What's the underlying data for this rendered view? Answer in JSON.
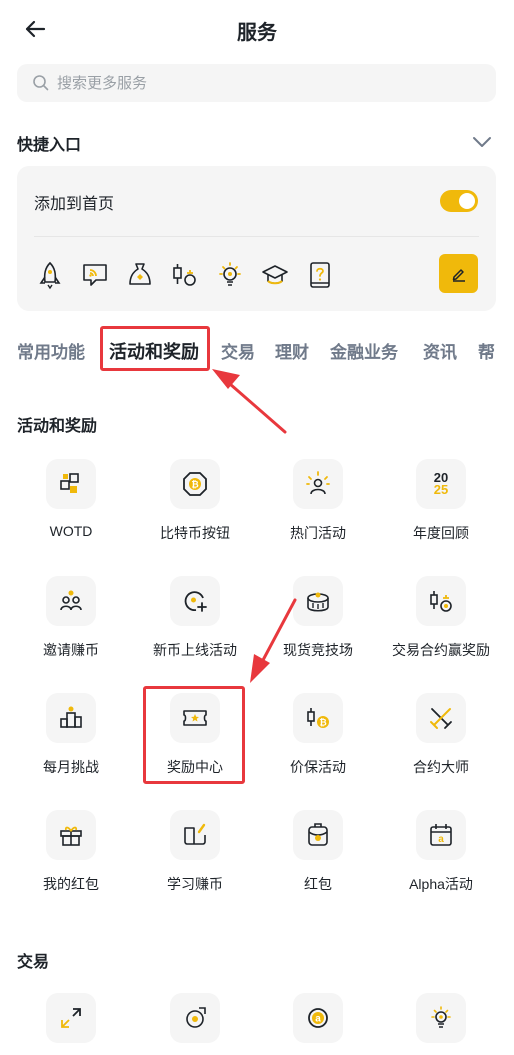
{
  "header": {
    "title": "服务"
  },
  "search": {
    "placeholder": "搜索更多服务"
  },
  "quick_access": {
    "title": "快捷入口",
    "add_to_home_label": "添加到首页",
    "toggle_on": true,
    "icons": [
      "rocket-icon",
      "broadcast-icon",
      "moneybag-icon",
      "trade-icon",
      "bulb-icon",
      "graduation-cap-icon",
      "help-book-icon"
    ]
  },
  "tabs": [
    "常用功能",
    "活动和奖励",
    "交易",
    "理财",
    "金融业务",
    "资讯",
    "帮"
  ],
  "active_tab": "活动和奖励",
  "rewards_section": {
    "title": "活动和奖励",
    "items": [
      {
        "label": "WOTD",
        "icon": "wotd-icon"
      },
      {
        "label": "比特币按钮",
        "icon": "bitcoin-button-icon"
      },
      {
        "label": "热门活动",
        "icon": "hot-activity-icon"
      },
      {
        "label": "年度回顾",
        "icon": "year-review-icon",
        "icon_text_top": "20",
        "icon_text_bottom": "25"
      },
      {
        "label": "邀请赚币",
        "icon": "invite-icon"
      },
      {
        "label": "新币上线活动",
        "icon": "new-coin-icon"
      },
      {
        "label": "现货竞技场",
        "icon": "spot-arena-icon"
      },
      {
        "label": "交易合约赢奖励",
        "icon": "futures-reward-icon"
      },
      {
        "label": "每月挑战",
        "icon": "monthly-challenge-icon"
      },
      {
        "label": "奖励中心",
        "icon": "ticket-icon"
      },
      {
        "label": "价保活动",
        "icon": "price-protect-icon"
      },
      {
        "label": "合约大师",
        "icon": "swords-icon"
      },
      {
        "label": "我的红包",
        "icon": "gift-icon"
      },
      {
        "label": "学习赚币",
        "icon": "learn-earn-icon"
      },
      {
        "label": "红包",
        "icon": "red-packet-icon"
      },
      {
        "label": "Alpha活动",
        "icon": "alpha-calendar-icon"
      }
    ]
  },
  "trade_section": {
    "title": "交易",
    "items": [
      {
        "icon": "convert-icon"
      },
      {
        "icon": "coin-swap-icon"
      },
      {
        "icon": "alpha-icon"
      },
      {
        "icon": "bulb-icon"
      }
    ]
  },
  "colors": {
    "accent": "#F0B90B",
    "highlight": "#E8383D",
    "text": "#1E2329",
    "muted": "#707A8A",
    "bg_gray": "#F5F5F5"
  }
}
